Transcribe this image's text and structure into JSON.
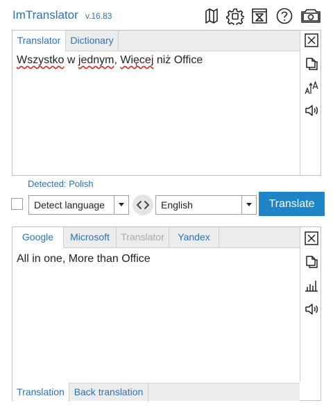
{
  "app": {
    "title": "ImTranslator",
    "version": "v.16.83"
  },
  "header_icons": [
    "map-icon",
    "settings-gear-icon",
    "history-hourglass-icon",
    "help-icon",
    "camera-icon"
  ],
  "source_panel": {
    "tabs": [
      {
        "label": "Translator",
        "active": true
      },
      {
        "label": "Dictionary",
        "active": false
      }
    ],
    "text_words": [
      "Wszystko",
      " w ",
      "jednym",
      ", ",
      "Więcej",
      " niż Office"
    ],
    "spellcheck_flagged": [
      "Wszystko",
      "jednym",
      "Więcej"
    ],
    "side_icons": [
      "close-icon",
      "copy-icon",
      "font-size-icon",
      "speaker-icon"
    ]
  },
  "controls": {
    "detected_label": "Detected: Polish",
    "source_language": "Detect language",
    "target_language": "English",
    "translate_label": "Translate"
  },
  "result_panel": {
    "tabs": [
      {
        "label": "Google",
        "active": true,
        "disabled": false
      },
      {
        "label": "Microsoft",
        "active": false,
        "disabled": false
      },
      {
        "label": "Translator",
        "active": false,
        "disabled": true
      },
      {
        "label": "Yandex",
        "active": false,
        "disabled": false
      }
    ],
    "text": "All in one, More than Office",
    "side_icons": [
      "close-icon",
      "copy-icon",
      "bar-chart-icon",
      "speaker-icon"
    ],
    "bottom_tabs": [
      {
        "label": "Translation",
        "active": true
      },
      {
        "label": "Back translation",
        "active": false
      }
    ]
  },
  "colors": {
    "accent": "#2a73b8",
    "button": "#1e86c6",
    "tabbar": "#ececec",
    "border": "#bdbdbd",
    "spellcheck": "#dd2222"
  }
}
